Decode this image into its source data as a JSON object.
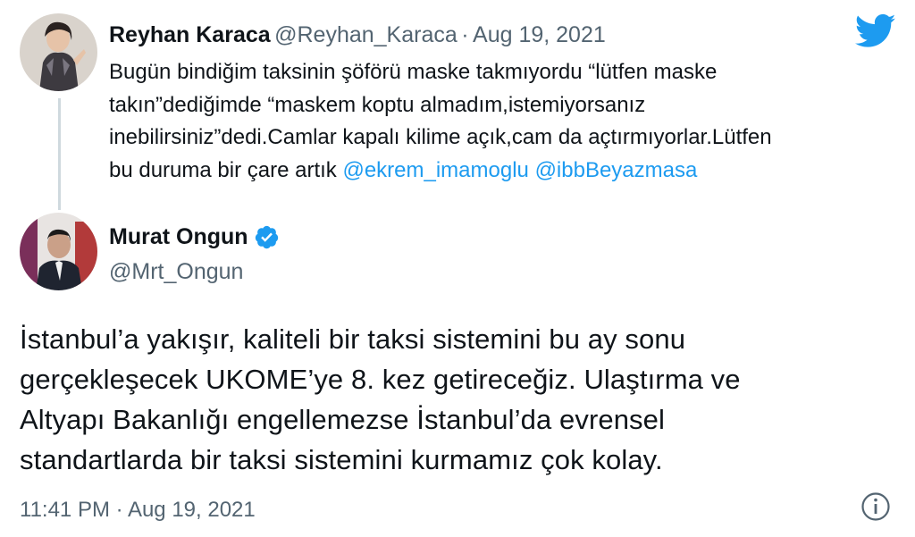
{
  "quoted_tweet": {
    "display_name": "Reyhan Karaca",
    "handle": "@Reyhan_Karaca",
    "separator": "·",
    "date": "Aug 19, 2021",
    "text_lines": [
      "Bugün bindiğim taksinin şöförü maske takmıyordu “lütfen maske",
      "takın”dediğimde “maskem koptu almadım,istemiyorsanız",
      "inebilirsiniz”dedi.Camlar kapalı kilime açık,cam da açtırmıyorlar.Lütfen"
    ],
    "last_line_text": "bu duruma bir çare artık ",
    "mentions": [
      "@ekrem_imamoglu",
      "@ibbBeyazmasa"
    ]
  },
  "reply_tweet": {
    "display_name": "Murat Ongun",
    "verified": true,
    "handle": "@Mrt_Ongun",
    "text_lines": [
      "İstanbul’a yakışır, kaliteli bir taksi sistemini bu ay sonu",
      "gerçekleşecek UKOME’ye 8. kez getireceğiz. Ulaştırma ve",
      "Altyapı Bakanlığı engellemezse İstanbul’da evrensel",
      "standartlarda bir taksi sistemini kurmamız çok kolay."
    ],
    "timestamp": "11:41 PM · Aug 19, 2021"
  },
  "icons": {
    "brand": "twitter-bird-icon",
    "verified": "verified-badge-icon",
    "info": "info-icon"
  },
  "colors": {
    "brand_blue": "#1d9bf0",
    "text": "#0f1419",
    "secondary": "#536471",
    "thread_line": "#cfd9de"
  }
}
